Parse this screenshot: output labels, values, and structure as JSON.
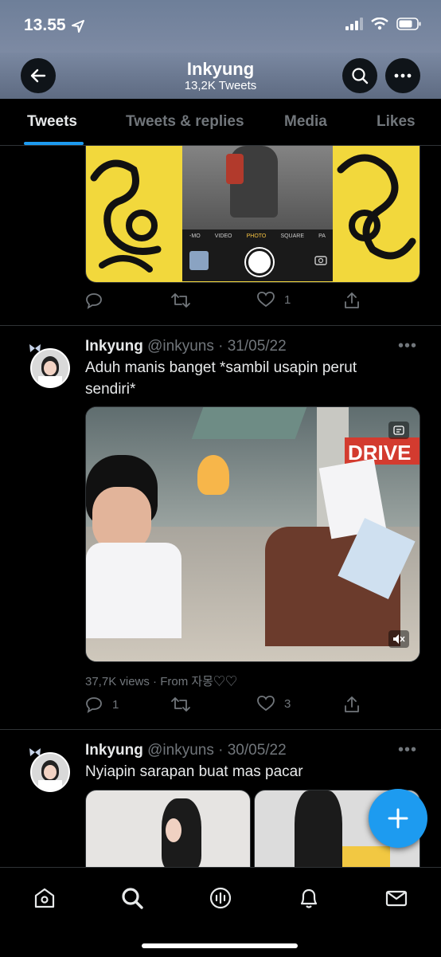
{
  "status_bar": {
    "time": "13.55"
  },
  "header": {
    "title": "Inkyung",
    "subtitle": "13,2K Tweets"
  },
  "tabs": [
    {
      "label": "Tweets",
      "active": true
    },
    {
      "label": "Tweets & replies",
      "active": false
    },
    {
      "label": "Media",
      "active": false
    },
    {
      "label": "Likes",
      "active": false
    }
  ],
  "tweet_prev": {
    "camera_modes": [
      "-MO",
      "VIDEO",
      "PHOTO",
      "SQUARE",
      "PA"
    ],
    "likes": "1"
  },
  "tweet1": {
    "name": "Inkyung",
    "meta": "@inkyuns · 31/05/22",
    "text": "Aduh manis banget *sambil usapin perut sendiri*",
    "sign_text": "DRIVE",
    "views": "37,7K views · From 자몽♡♡",
    "replies": "1",
    "likes": "3"
  },
  "tweet2": {
    "name": "Inkyung",
    "meta": "@inkyuns · 30/05/22",
    "text": "Nyiapin sarapan buat mas pacar"
  },
  "colors": {
    "accent": "#1d9bf0",
    "background": "#000000",
    "muted": "#71767b"
  }
}
